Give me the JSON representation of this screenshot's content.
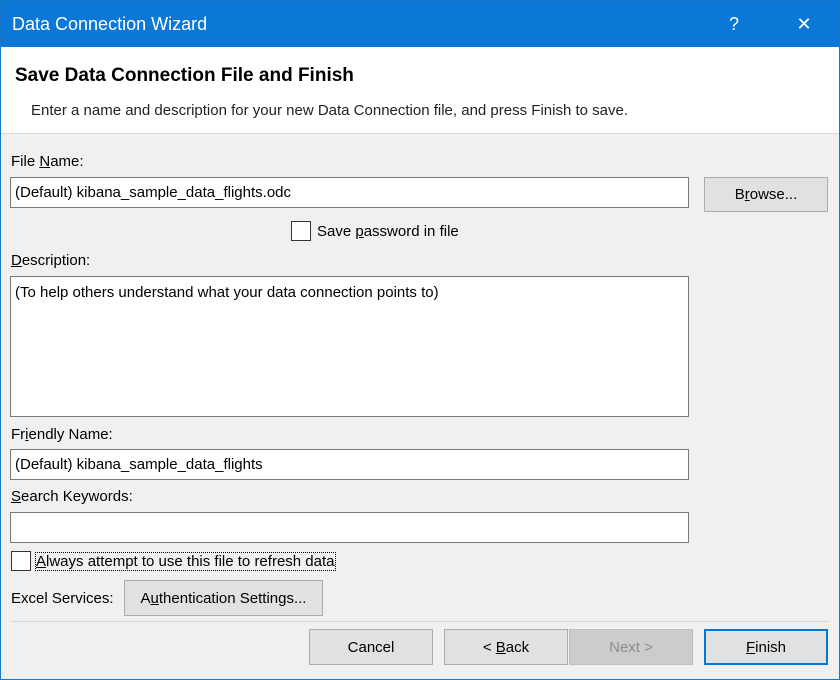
{
  "window": {
    "title": "Data Connection Wizard",
    "help_glyph": "?",
    "close_glyph": "✕"
  },
  "header": {
    "title": "Save Data Connection File and Finish",
    "subtitle": "Enter a name and description for your new Data Connection file, and press Finish to save."
  },
  "form": {
    "file_name_label_pre": "File ",
    "file_name_label_key": "N",
    "file_name_label_post": "ame:",
    "file_name_value": "(Default) kibana_sample_data_flights.odc",
    "browse_pre": "B",
    "browse_key": "r",
    "browse_post": "owse...",
    "save_password_pre": "Save ",
    "save_password_key": "p",
    "save_password_post": "assword in file",
    "save_password_checked": false,
    "description_label_key": "D",
    "description_label_post": "escription:",
    "description_value": "(To help others understand what your data connection points to)",
    "friendly_label_pre": "Fr",
    "friendly_label_key": "i",
    "friendly_label_post": "endly Name:",
    "friendly_value": "(Default) kibana_sample_data_flights",
    "keywords_label_key": "S",
    "keywords_label_post": "earch Keywords:",
    "keywords_value": "",
    "always_key": "A",
    "always_post": "lways attempt to use this file to refresh data",
    "always_checked": false,
    "excel_services_label": "Excel Services:",
    "auth_pre": "A",
    "auth_key": "u",
    "auth_post": "thentication Settings..."
  },
  "footer": {
    "cancel": "Cancel",
    "back_pre": "< ",
    "back_key": "B",
    "back_post": "ack",
    "next": "Next >",
    "finish_key": "F",
    "finish_post": "inish"
  },
  "colors": {
    "titlebar": "#0b78d7",
    "accent": "#0078d7"
  }
}
